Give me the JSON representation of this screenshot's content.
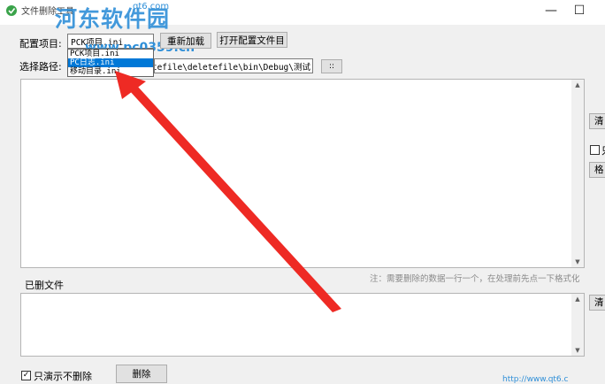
{
  "window": {
    "title": "文件删除工具",
    "minimize_glyph": "—",
    "maximize_glyph": "☐"
  },
  "watermark": {
    "text": "河东软件园",
    "url": "www.pc0359.cn",
    "top_url": "qt6.com"
  },
  "config": {
    "label": "配置项目:",
    "selected_value": "PCK项目.ini",
    "options": [
      "PCK项目.ini",
      "PCK项目.ini",
      "PC日志.ini",
      "移动目录.ini"
    ],
    "highlighted_index": 2,
    "reload_label": "重新加载",
    "open_config_label": "打开配置文件目"
  },
  "path": {
    "label": "选择路径:",
    "value": "\\deletefile\\deletefile\\bin\\Debug\\测试",
    "browse_label": "::"
  },
  "side": {
    "clear_top_label": "清",
    "check_label": "只",
    "other_label": "格",
    "clear_bottom_label": "清"
  },
  "deleted": {
    "label": "已删文件",
    "hint": "注：需要删除的数据一行一个，在处理前先点一下格式化"
  },
  "bottom": {
    "demo_label": "只演示不删除",
    "demo_checked": true,
    "delete_label": "删除",
    "link_text": "http://www.qt6.c"
  },
  "colors": {
    "watermark": "#2f8fd8",
    "arrow": "#ee2a24",
    "selection": "#0078d7"
  }
}
